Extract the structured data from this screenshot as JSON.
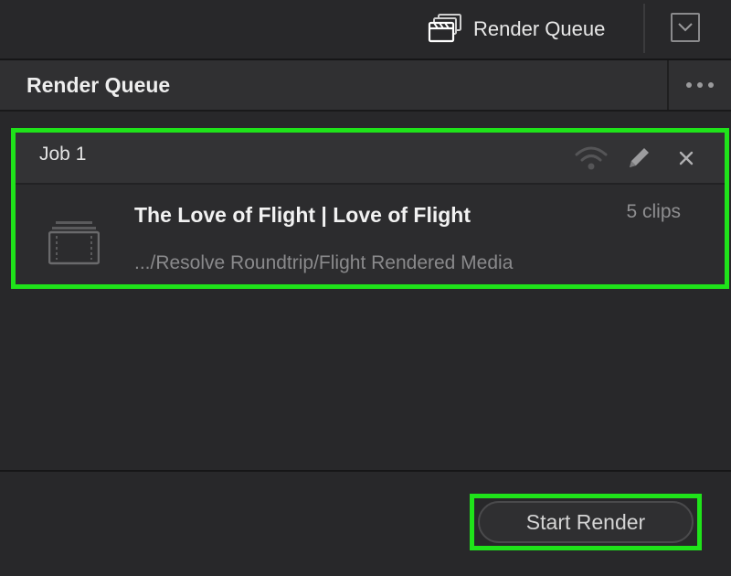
{
  "topbar": {
    "icon": "clapperboard-stack-icon",
    "label": "Render Queue",
    "dropdown_icon": "chevron-down-icon"
  },
  "panel": {
    "title": "Render Queue",
    "more_icon": "ellipsis-icon"
  },
  "job": {
    "title": "Job 1",
    "actions": [
      "remote-render-icon",
      "pencil-icon",
      "close-icon"
    ],
    "name": "The Love of Flight | Love of Flight",
    "path": ".../Resolve Roundtrip/Flight Rendered Media",
    "clips": "5 clips",
    "thumbnail_icon": "clip-stack-icon"
  },
  "footer": {
    "start_label": "Start Render"
  },
  "colors": {
    "highlight": "#1fe31a",
    "background": "#28282a",
    "panel_header": "#303032"
  }
}
